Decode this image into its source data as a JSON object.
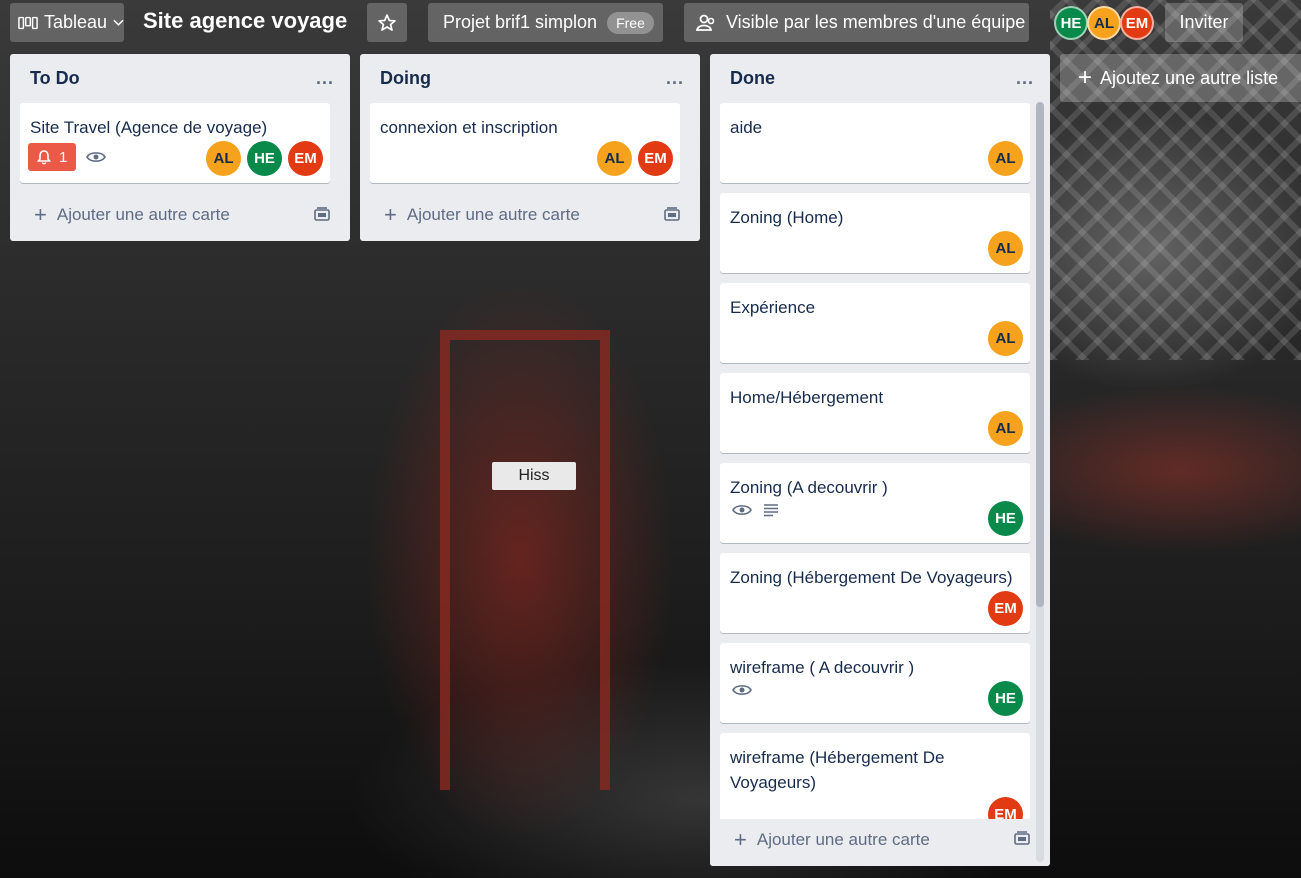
{
  "header": {
    "board_menu_label": "Tableau",
    "board_title": "Site agence voyage",
    "workspace_label": "Projet brif1 simplon",
    "workspace_badge": "Free",
    "visibility_label": "Visible par les membres d'une équipe",
    "members": [
      "HE",
      "AL",
      "EM"
    ],
    "invite_label": "Inviter"
  },
  "lists": [
    {
      "title": "To Do",
      "menu": "...",
      "cards": [
        {
          "title": "Site Travel (Agence de voyage)",
          "notifications": "1",
          "members": [
            "AL",
            "HE",
            "EM"
          ]
        }
      ],
      "add_card_label": "Ajouter une autre carte"
    },
    {
      "title": "Doing",
      "menu": "...",
      "cards": [
        {
          "title": "connexion et inscription",
          "members": [
            "AL",
            "EM"
          ]
        }
      ],
      "add_card_label": "Ajouter une autre carte"
    },
    {
      "title": "Done",
      "menu": "...",
      "cards": [
        {
          "title": "aide",
          "members": [
            "AL"
          ]
        },
        {
          "title": "Zoning (Home)",
          "members": [
            "AL"
          ]
        },
        {
          "title": "Expérience",
          "members": [
            "AL"
          ]
        },
        {
          "title": "Home/Hébergement",
          "members": [
            "AL"
          ]
        },
        {
          "title": "Zoning (A decouvrir )",
          "members": [
            "HE"
          ]
        },
        {
          "title": "Zoning (Hébergement De Voyageurs)",
          "members": [
            "EM"
          ]
        },
        {
          "title": "wireframe ( A decouvrir )",
          "members": [
            "HE"
          ]
        },
        {
          "title": "wireframe (Hébergement De Voyageurs)",
          "members": [
            "EM"
          ]
        }
      ],
      "add_card_label": "Ajouter une autre carte"
    }
  ],
  "add_list_label": "Ajoutez une autre liste",
  "background_sign_text": "Hiss",
  "colors": {
    "AL": "#f6a21c",
    "HE": "#0a8a4a",
    "EM": "#e23a12",
    "notification": "#eb5a46",
    "list_bg": "#ebecf0"
  }
}
